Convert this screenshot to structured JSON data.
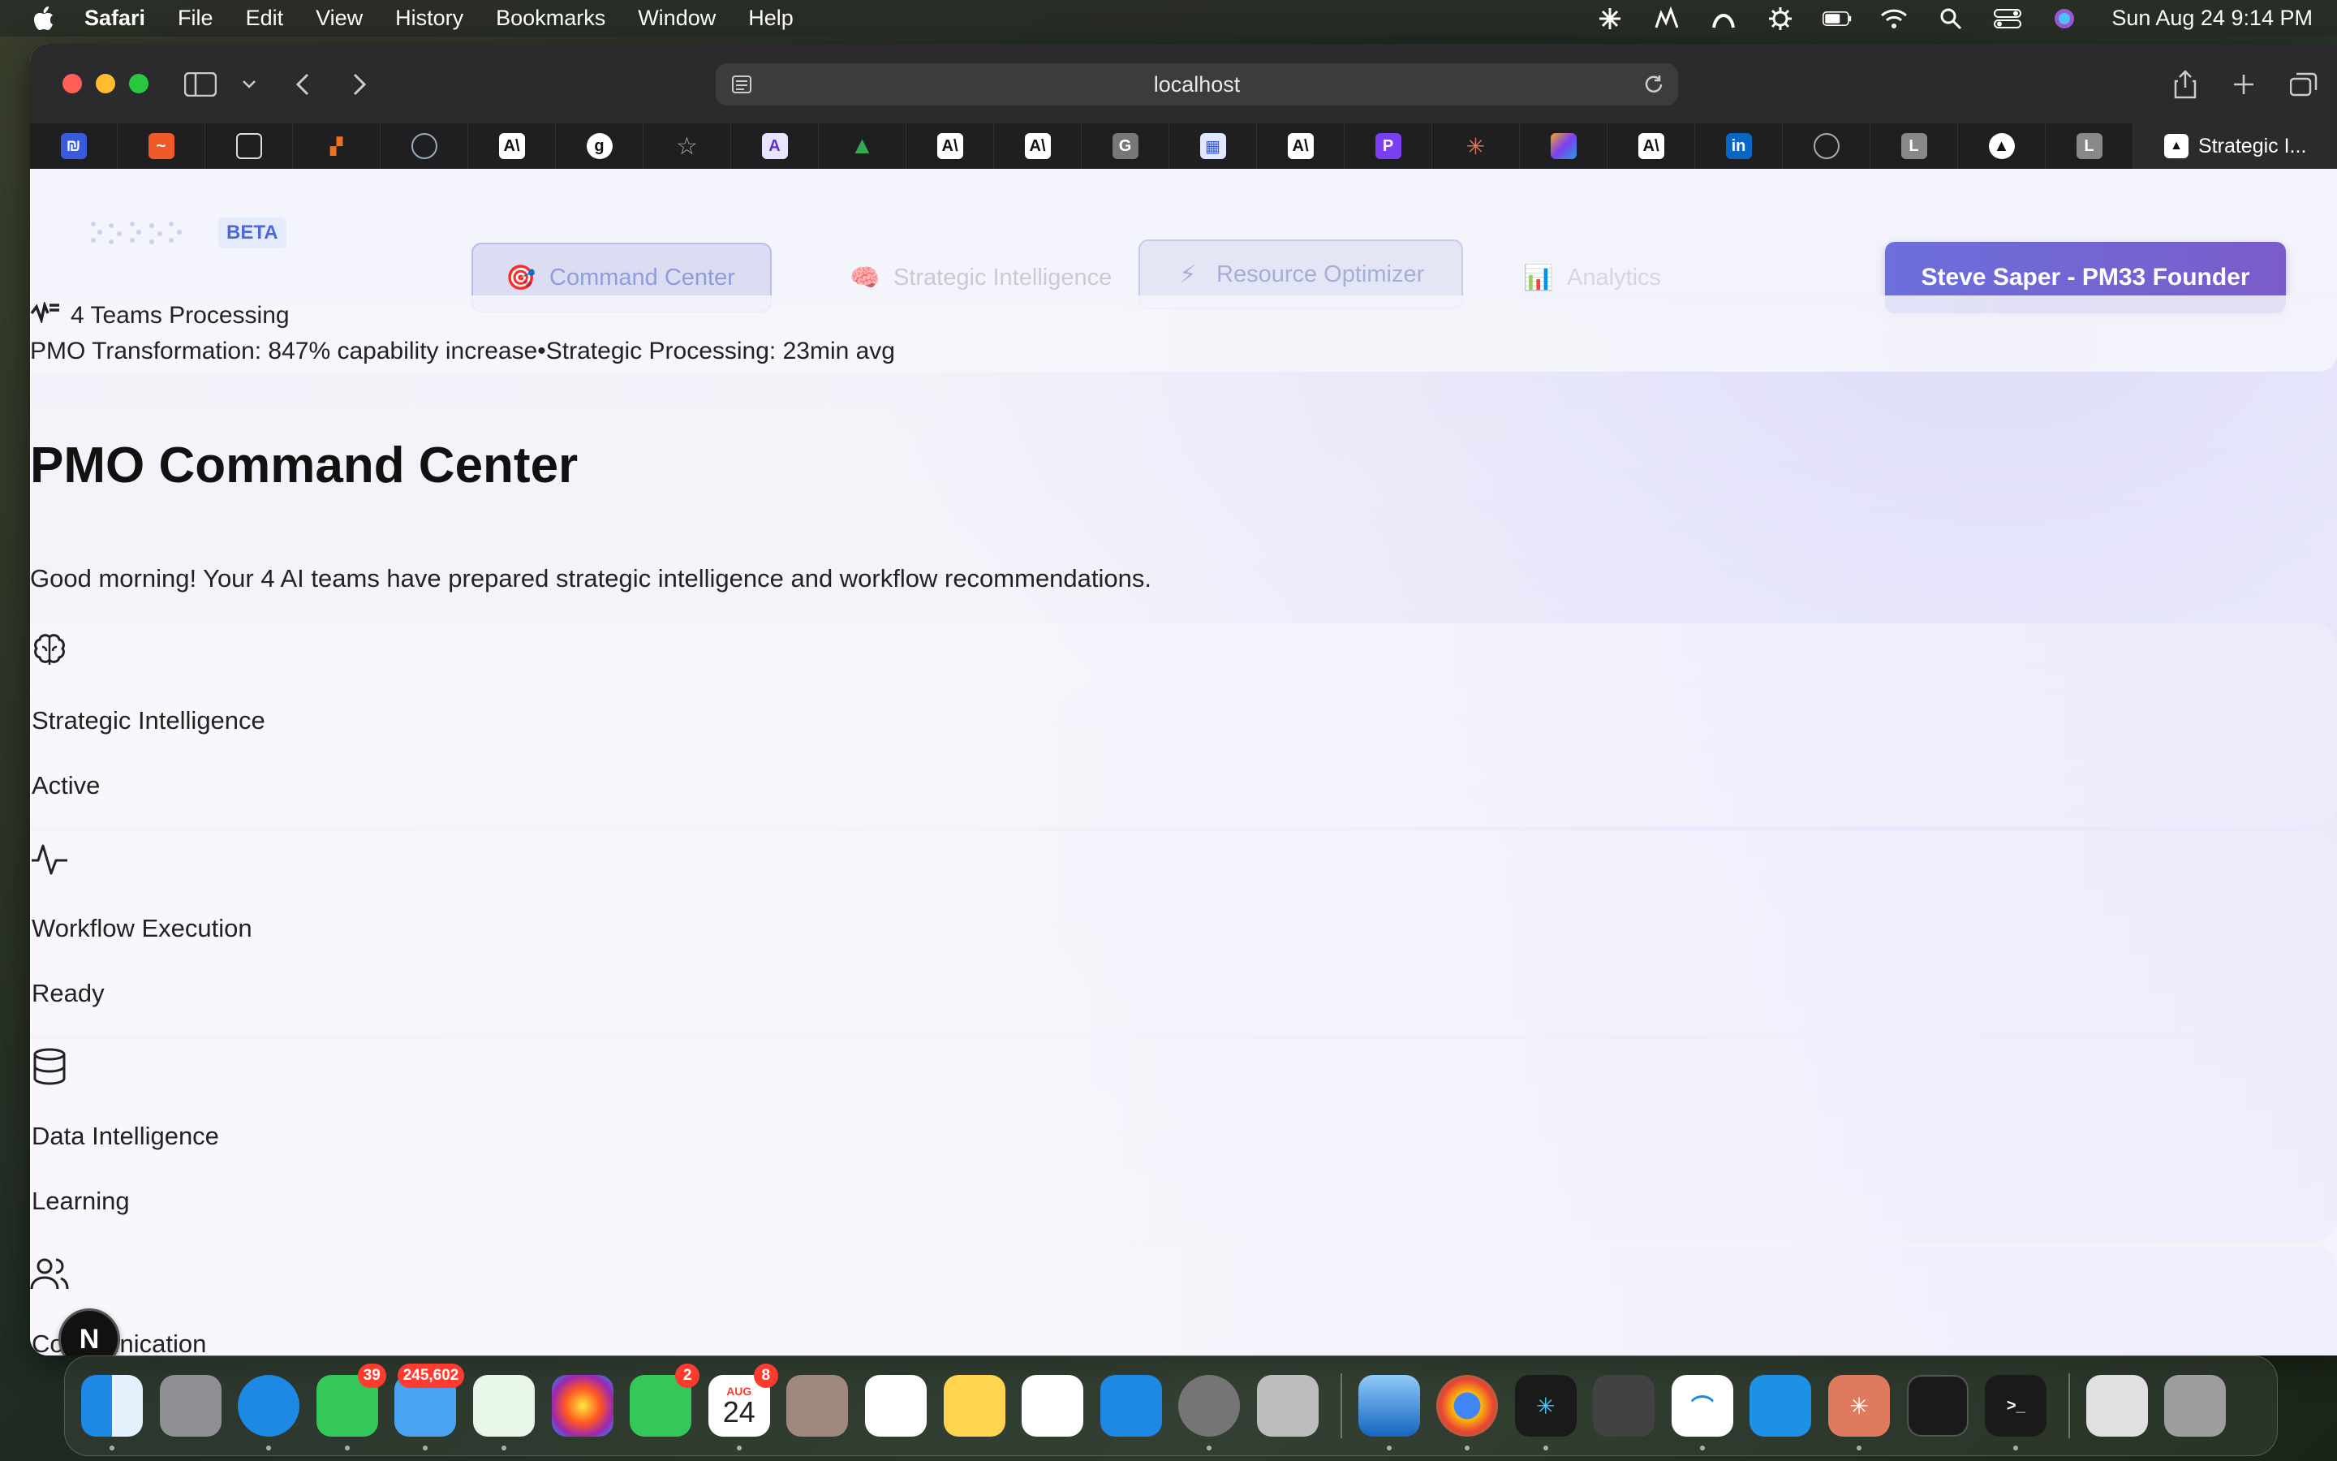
{
  "menubar": {
    "app_name": "Safari",
    "items": [
      "File",
      "Edit",
      "View",
      "History",
      "Bookmarks",
      "Window",
      "Help"
    ],
    "clock": "Sun Aug 24  9:14 PM"
  },
  "browser": {
    "url": "localhost",
    "active_tab_title": "Strategic I..."
  },
  "app": {
    "beta_label": "BETA",
    "nav": [
      {
        "icon": "🎯",
        "label": "Command Center"
      },
      {
        "icon": "🧠",
        "label": "Strategic Intelligence"
      },
      {
        "icon": "⚡",
        "label": "Resource Optimizer"
      },
      {
        "icon": "📊",
        "label": "Analytics"
      }
    ],
    "user_button": "Steve Saper - PM33 Founder"
  },
  "status": {
    "teams_processing": "4 Teams Processing",
    "metrics": "PMO Transformation: 847% capability increase•Strategic Processing: 23min avg"
  },
  "main": {
    "title": "PMO Command Center",
    "greeting": "Good morning! Your 4 AI teams have prepared strategic intelligence and workflow recommendations."
  },
  "teams": [
    {
      "icon": "brain-icon",
      "name": "Strategic Intelligence",
      "status": "Active"
    },
    {
      "icon": "activity-icon",
      "name": "Workflow Execution",
      "status": "Ready"
    },
    {
      "icon": "database-icon",
      "name": "Data Intelligence",
      "status": "Learning"
    },
    {
      "icon": "users-icon",
      "name": "Communication",
      "status": ""
    }
  ],
  "overlay": {
    "dev_badge": "N"
  },
  "dock": {
    "messages_badge": "39",
    "mail_badge": "245,602",
    "facetime_badge": "2",
    "calendar_badge": "8",
    "calendar_month": "AUG",
    "calendar_day": "24"
  }
}
